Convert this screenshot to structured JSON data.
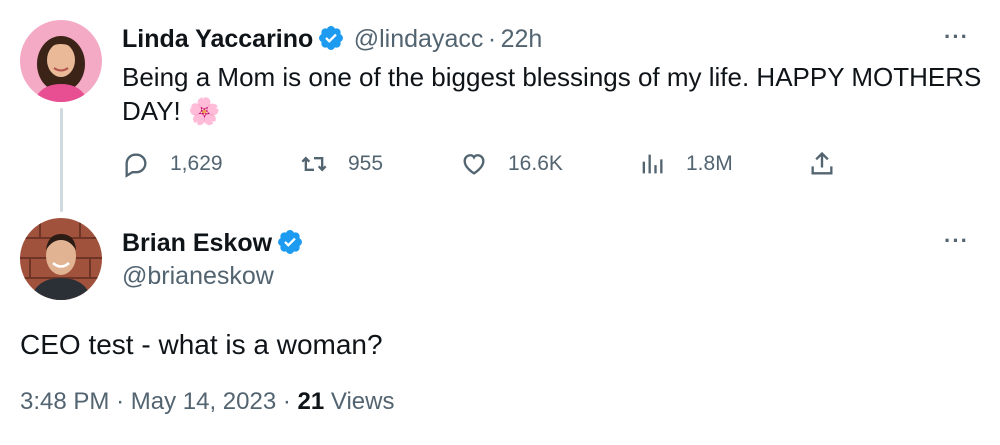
{
  "tweet1": {
    "author_name": "Linda Yaccarino",
    "handle": "@lindayacc",
    "separator": "·",
    "time": "22h",
    "text_line1": "Being a Mom is one of the biggest blessings of my life. HAPPY MOTHERS",
    "text_line2": "DAY! 🌸",
    "more_label": "···",
    "actions": {
      "replies": "1,629",
      "retweets": "955",
      "likes": "16.6K",
      "views": "1.8M"
    }
  },
  "tweet2": {
    "author_name": "Brian Eskow",
    "handle": "@brianeskow",
    "more_label": "···",
    "text": "CEO test - what is a woman?",
    "time": "3:48 PM",
    "date": "May 14, 2023",
    "dot": "·",
    "views_count": "21",
    "views_label": "Views"
  },
  "colors": {
    "verified": "#1d9bf0",
    "secondary_text": "#536471",
    "primary_text": "#0f1419",
    "thread_line": "#cfd9de"
  }
}
